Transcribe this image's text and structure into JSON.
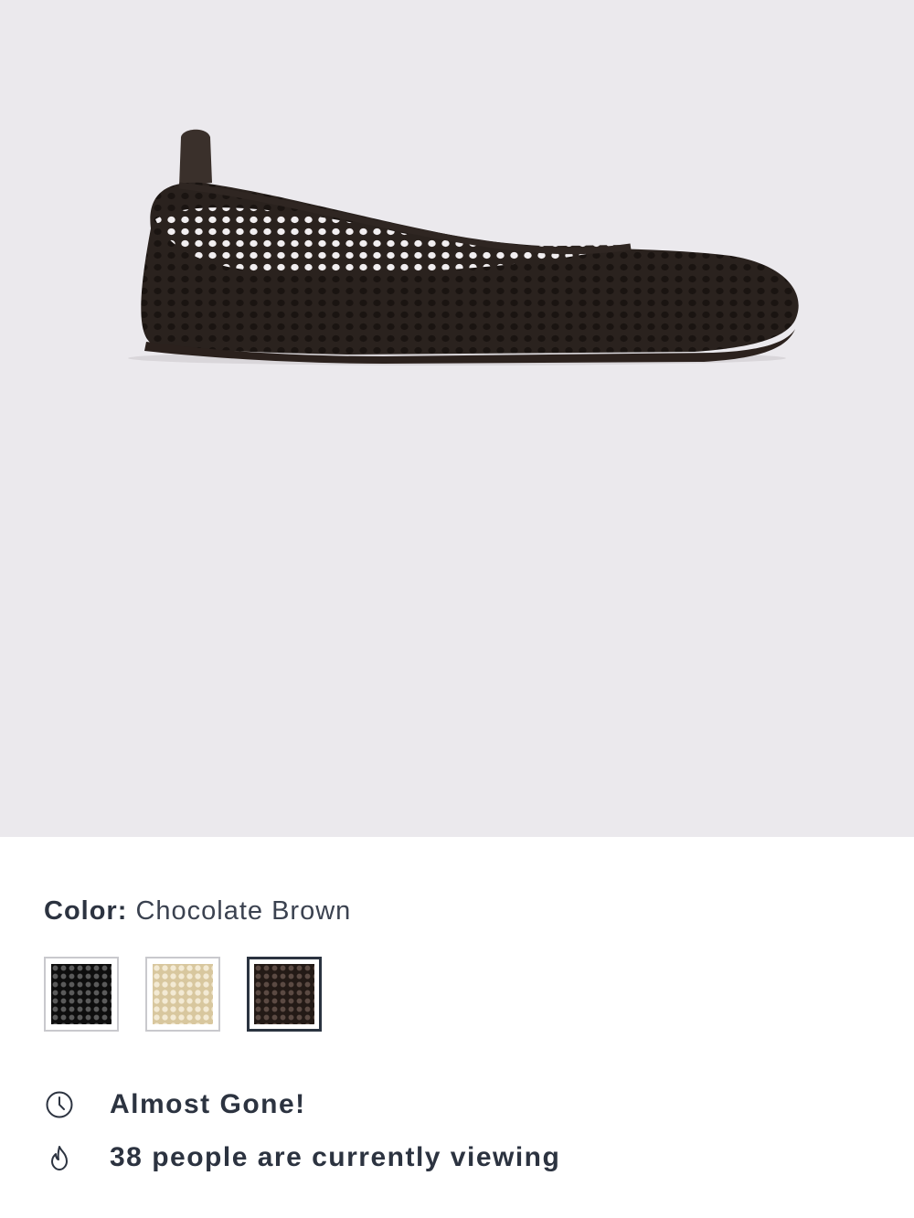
{
  "product": {
    "image_alt": "Woven mesh ballet flat in Chocolate Brown"
  },
  "color": {
    "label": "Color:",
    "selected": "Chocolate Brown",
    "swatches": [
      {
        "name": "Black",
        "hex": "#0e0e0e",
        "selected": false
      },
      {
        "name": "Cream",
        "hex": "#d8c79e",
        "selected": false
      },
      {
        "name": "Chocolate Brown",
        "hex": "#231a16",
        "selected": true
      }
    ]
  },
  "status": {
    "almost_gone": {
      "icon": "clock-icon",
      "text": "Almost Gone!"
    },
    "viewing": {
      "icon": "flame-icon",
      "text": "38 people are currently viewing"
    }
  },
  "colors": {
    "hero_bg": "#ebe9ed",
    "text": "#2c3340",
    "selected_border": "#2b3340"
  }
}
